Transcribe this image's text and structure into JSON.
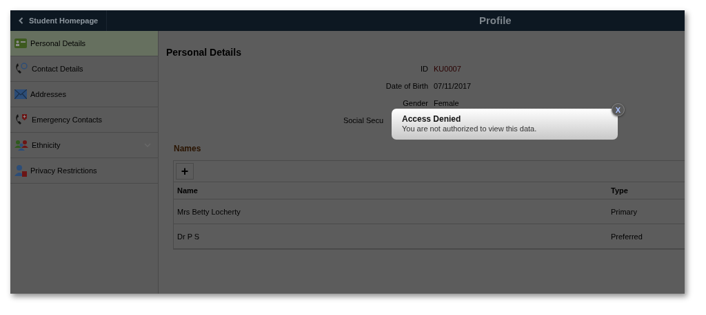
{
  "header": {
    "back_label": "Student Homepage",
    "title": "Profile"
  },
  "sidebar": {
    "items": [
      {
        "label": "Personal Details",
        "selected": true,
        "expandable": false
      },
      {
        "label": "Contact Details",
        "selected": false,
        "expandable": false
      },
      {
        "label": "Addresses",
        "selected": false,
        "expandable": false
      },
      {
        "label": "Emergency Contacts",
        "selected": false,
        "expandable": false
      },
      {
        "label": "Ethnicity",
        "selected": false,
        "expandable": true
      },
      {
        "label": "Privacy Restrictions",
        "selected": false,
        "expandable": false
      }
    ]
  },
  "main": {
    "heading": "Personal Details",
    "fields": [
      {
        "label": "ID",
        "value": "KU0007"
      },
      {
        "label": "Date of Birth",
        "value": "07/11/2017"
      },
      {
        "label": "Gender",
        "value": "Female"
      },
      {
        "label": "Social Secu"
      }
    ],
    "names": {
      "heading": "Names",
      "add_button": "+",
      "columns": [
        "Name",
        "Type"
      ],
      "rows": [
        [
          "Mrs Betty Locherty",
          "Primary"
        ],
        [
          "Dr P S",
          "Preferred"
        ]
      ]
    }
  },
  "dialog": {
    "title": "Access Denied",
    "message": "You are not authorized to view this data.",
    "close": "X"
  }
}
